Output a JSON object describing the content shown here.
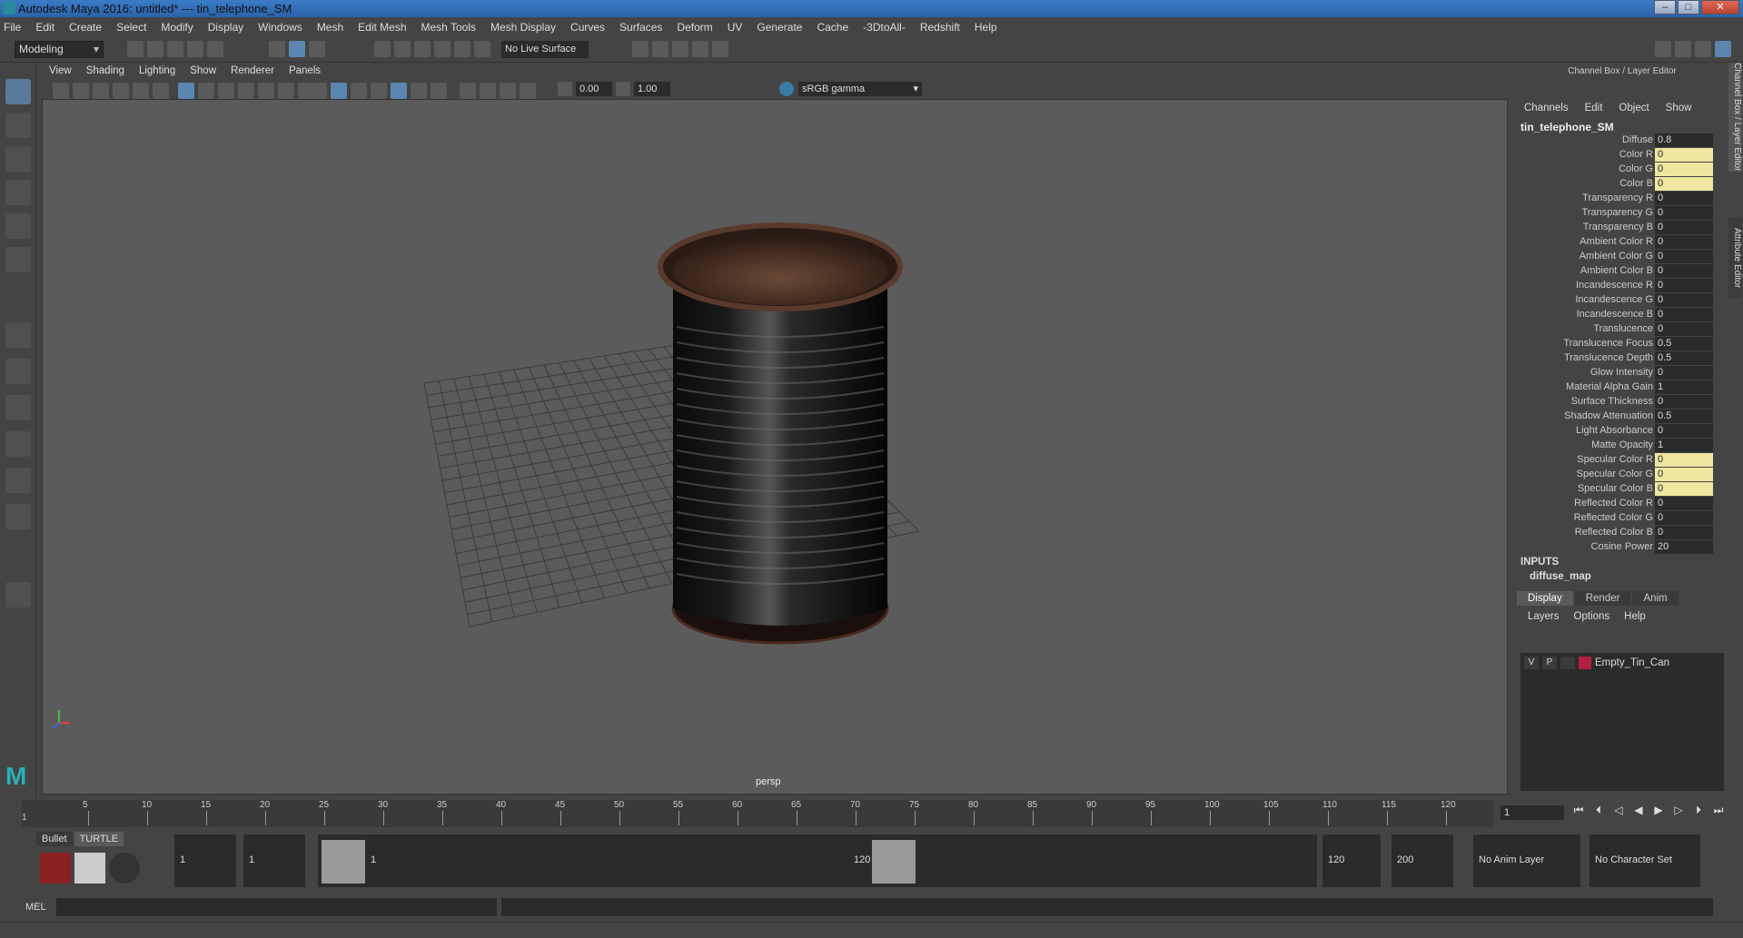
{
  "window": {
    "title": "Autodesk Maya 2016: untitled*   ---   tin_telephone_SM"
  },
  "menubar": [
    "File",
    "Edit",
    "Create",
    "Select",
    "Modify",
    "Display",
    "Windows",
    "Mesh",
    "Edit Mesh",
    "Mesh Tools",
    "Mesh Display",
    "Curves",
    "Surfaces",
    "Deform",
    "UV",
    "Generate",
    "Cache",
    "-3DtoAll-",
    "Redshift",
    "Help"
  ],
  "shelf": {
    "mode": "Modeling",
    "live_surface": "No Live Surface"
  },
  "viewport": {
    "menu": [
      "View",
      "Shading",
      "Lighting",
      "Show",
      "Renderer",
      "Panels"
    ],
    "exposure": "0.00",
    "gamma": "1.00",
    "color_space": "sRGB gamma",
    "camera": "persp"
  },
  "channel_box": {
    "title": "Channel Box / Layer Editor",
    "menu": [
      "Channels",
      "Edit",
      "Object",
      "Show"
    ],
    "object": "tin_telephone_SM",
    "attributes": [
      {
        "name": "Diffuse",
        "value": "0.8",
        "hl": false
      },
      {
        "name": "Color R",
        "value": "0",
        "hl": true
      },
      {
        "name": "Color G",
        "value": "0",
        "hl": true
      },
      {
        "name": "Color B",
        "value": "0",
        "hl": true
      },
      {
        "name": "Transparency R",
        "value": "0",
        "hl": false
      },
      {
        "name": "Transparency G",
        "value": "0",
        "hl": false
      },
      {
        "name": "Transparency B",
        "value": "0",
        "hl": false
      },
      {
        "name": "Ambient Color R",
        "value": "0",
        "hl": false
      },
      {
        "name": "Ambient Color G",
        "value": "0",
        "hl": false
      },
      {
        "name": "Ambient Color B",
        "value": "0",
        "hl": false
      },
      {
        "name": "Incandescence R",
        "value": "0",
        "hl": false
      },
      {
        "name": "Incandescence G",
        "value": "0",
        "hl": false
      },
      {
        "name": "Incandescence B",
        "value": "0",
        "hl": false
      },
      {
        "name": "Translucence",
        "value": "0",
        "hl": false
      },
      {
        "name": "Translucence Focus",
        "value": "0.5",
        "hl": false
      },
      {
        "name": "Translucence Depth",
        "value": "0.5",
        "hl": false
      },
      {
        "name": "Glow Intensity",
        "value": "0",
        "hl": false
      },
      {
        "name": "Material Alpha Gain",
        "value": "1",
        "hl": false
      },
      {
        "name": "Surface Thickness",
        "value": "0",
        "hl": false
      },
      {
        "name": "Shadow Attenuation",
        "value": "0.5",
        "hl": false
      },
      {
        "name": "Light Absorbance",
        "value": "0",
        "hl": false
      },
      {
        "name": "Matte Opacity",
        "value": "1",
        "hl": false
      },
      {
        "name": "Specular Color R",
        "value": "0",
        "hl": true
      },
      {
        "name": "Specular Color G",
        "value": "0",
        "hl": true
      },
      {
        "name": "Specular Color B",
        "value": "0",
        "hl": true
      },
      {
        "name": "Reflected Color R",
        "value": "0",
        "hl": false
      },
      {
        "name": "Reflected Color G",
        "value": "0",
        "hl": false
      },
      {
        "name": "Reflected Color B",
        "value": "0",
        "hl": false
      },
      {
        "name": "Cosine Power",
        "value": "20",
        "hl": false
      }
    ],
    "inputs_label": "INPUTS",
    "inputs_item": "diffuse_map"
  },
  "layer_editor": {
    "tabs": [
      "Display",
      "Render",
      "Anim"
    ],
    "menu": [
      "Layers",
      "Options",
      "Help"
    ],
    "layer": {
      "v": "V",
      "p": "P",
      "name": "Empty_Tin_Can",
      "color": "#b22040"
    }
  },
  "side_tabs": [
    "Channel Box / Layer Editor",
    "Attribute Editor"
  ],
  "timeline": {
    "ticks": [
      "5",
      "10",
      "15",
      "20",
      "25",
      "30",
      "35",
      "40",
      "45",
      "50",
      "55",
      "60",
      "65",
      "70",
      "75",
      "80",
      "85",
      "90",
      "95",
      "100",
      "105",
      "110",
      "115",
      "120"
    ],
    "start_marker": "1",
    "current_frame": "1"
  },
  "range": {
    "shelf_tabs": [
      "Bullet",
      "TURTLE"
    ],
    "start": "1",
    "playback_start": "1",
    "range_start_label": "1",
    "range_end_label": "120",
    "playback_end": "120",
    "end": "200",
    "anim_layer": "No Anim Layer",
    "char_set": "No Character Set"
  },
  "cmdline": {
    "label": "MEL"
  }
}
